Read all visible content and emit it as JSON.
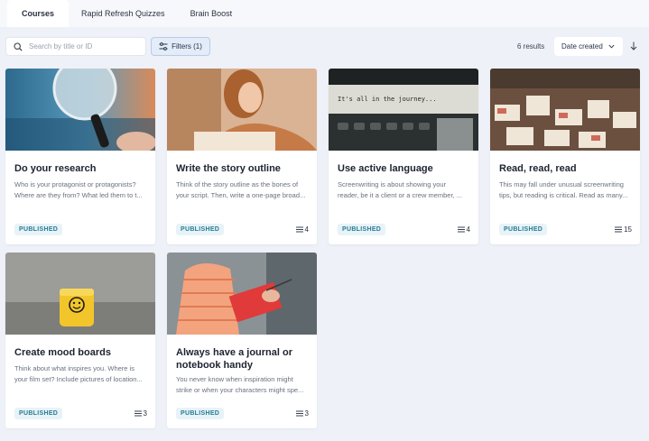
{
  "tabs": [
    "Courses",
    "Rapid Refresh Quizzes",
    "Brain Boost"
  ],
  "search": {
    "placeholder": "Search by title or ID"
  },
  "filters_label": "Filters (1)",
  "results_label": "6 results",
  "sort_label": "Date created",
  "accent": "#2a7a96",
  "cards": [
    {
      "title": "Do your research",
      "desc1": "Who is your protagonist or protagonists?",
      "desc2": "Where are they from? What led them to t...",
      "status": "PUBLISHED",
      "count": ""
    },
    {
      "title": "Write the story outline",
      "desc1": "Think of the story outline as the bones of",
      "desc2": "your script. Then, write a one-page broad...",
      "status": "PUBLISHED",
      "count": "4"
    },
    {
      "title": "Use active language",
      "desc1": "Screenwriting is about showing your",
      "desc2": "reader, be it a client or a crew member, ...",
      "status": "PUBLISHED",
      "count": "4"
    },
    {
      "title": "Read, read, read",
      "desc1": "This may fall under unusual screenwriting",
      "desc2": "tips, but reading is critical. Read as many...",
      "status": "PUBLISHED",
      "count": "15"
    },
    {
      "title": "Create mood boards",
      "desc1": "Think about what inspires you. Where is",
      "desc2": "your film set? Include pictures of location...",
      "status": "PUBLISHED",
      "count": "3"
    },
    {
      "title_line1": "Always have a journal or",
      "title_line2": "notebook handy",
      "desc1": "You never know when inspiration might",
      "desc2": "strike or when your characters might spe...",
      "status": "PUBLISHED",
      "count": "3"
    }
  ],
  "thumb_texts": {
    "typewriter": "It's all in the journey..."
  },
  "icons": {
    "search": "search-icon",
    "filter": "sliders-icon",
    "sort": "chevron-down-icon",
    "direction": "arrow-down-icon",
    "lessons": "list-icon"
  }
}
